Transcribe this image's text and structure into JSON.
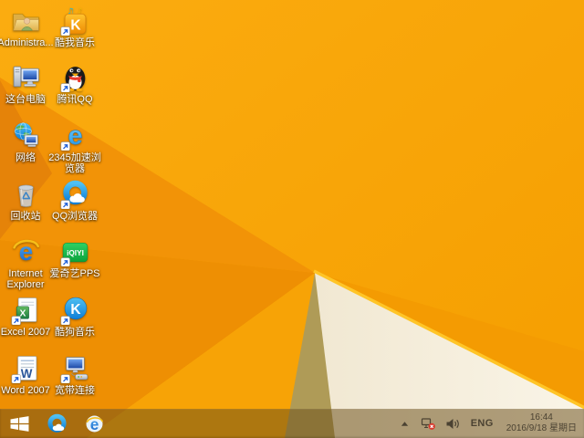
{
  "wallpaper": {
    "theme": "windows-8-orange-facets",
    "base_color": "#F8A406",
    "dark_facet_color": "#E58309",
    "white_facet_color": "#F6F0E1",
    "shadow_facet_color": "#AF9B57",
    "edge_highlight_color": "#FFC527"
  },
  "desktop": {
    "icons": [
      {
        "label": "Administra...",
        "icon": "user-folder"
      },
      {
        "label": "酷我音乐",
        "icon": "kuwo-music",
        "shortcut": true
      },
      {
        "label": "这台电脑",
        "icon": "this-pc"
      },
      {
        "label": "腾讯QQ",
        "icon": "tencent-qq",
        "shortcut": true
      },
      {
        "label": "网络",
        "icon": "network"
      },
      {
        "label": "2345加速浏览器",
        "icon": "2345-browser",
        "shortcut": true
      },
      {
        "label": "回收站",
        "icon": "recycle-bin"
      },
      {
        "label": "QQ浏览器",
        "icon": "qq-browser",
        "shortcut": true
      },
      {
        "label": "Internet Explorer",
        "icon": "internet-explorer"
      },
      {
        "label": "爱奇艺PPS",
        "icon": "iqiyi-pps",
        "shortcut": true
      },
      {
        "label": "Excel 2007",
        "icon": "excel-2007",
        "shortcut": true
      },
      {
        "label": "酷狗音乐",
        "icon": "kugou-music",
        "shortcut": true
      },
      {
        "label": "Word 2007",
        "icon": "word-2007",
        "shortcut": true
      },
      {
        "label": "宽带连接",
        "icon": "broadband-connection",
        "shortcut": true
      }
    ]
  },
  "taskbar": {
    "start_button": {
      "icon": "windows-logo"
    },
    "pinned": [
      {
        "label": "QQ浏览器",
        "icon": "qq-browser"
      },
      {
        "label": "Internet Explorer",
        "icon": "internet-explorer"
      }
    ],
    "tray": {
      "hidden_icons": "show-hidden-icons",
      "network_status": "disconnected",
      "volume": "speaker",
      "language": "ENG",
      "clock": {
        "time": "16:44",
        "date": "2016/9/18 星期日"
      }
    }
  }
}
